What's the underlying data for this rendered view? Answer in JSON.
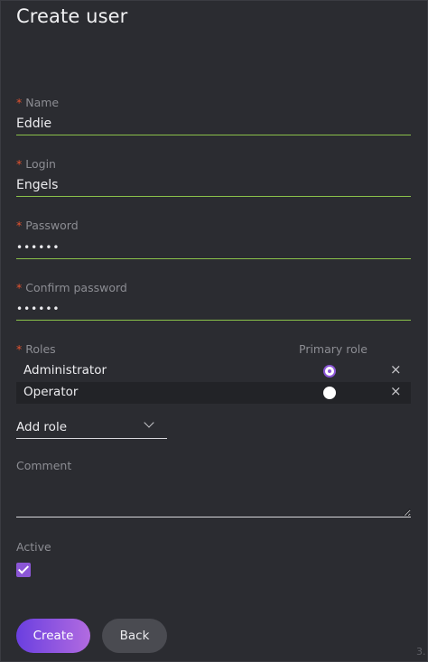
{
  "title": "Create user",
  "required_mark": "*",
  "fields": {
    "name": {
      "label": "Name",
      "value": "Eddie"
    },
    "login": {
      "label": "Login",
      "value": "Engels"
    },
    "password": {
      "label": "Password",
      "value": "••••••"
    },
    "confirm": {
      "label": "Confirm password",
      "value": "••••••"
    }
  },
  "roles": {
    "label": "Roles",
    "primary_label": "Primary role",
    "items": [
      {
        "name": "Administrator",
        "primary": true,
        "remove": "×"
      },
      {
        "name": "Operator",
        "primary": false,
        "remove": "×"
      }
    ],
    "add_role": "Add role"
  },
  "comment": {
    "label": "Comment",
    "value": ""
  },
  "active": {
    "label": "Active",
    "checked": true
  },
  "buttons": {
    "create": "Create",
    "back": "Back"
  },
  "version": "3.",
  "colors": {
    "background": "#2b2c31",
    "accent": "#8b56d6",
    "valid_underline": "#8ac14a",
    "required": "#e5532f"
  }
}
